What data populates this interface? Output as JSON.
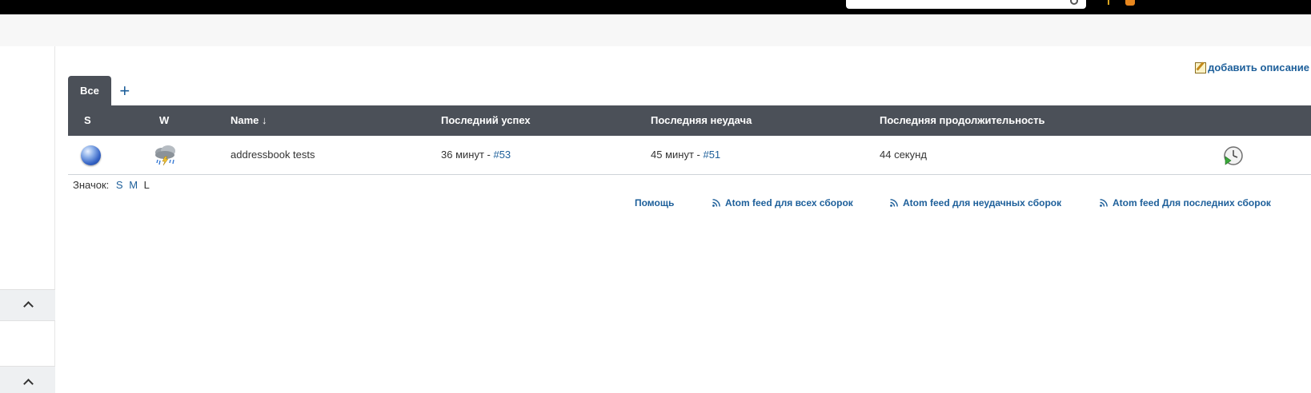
{
  "header": {
    "brand_colors": {
      "topbar": "#000000",
      "accent": "#e8871e"
    }
  },
  "description": {
    "add_label": "добавить описание"
  },
  "tabs": [
    {
      "label": "Все",
      "active": true
    }
  ],
  "tab_add_label": "+",
  "table": {
    "columns": [
      {
        "label": "S"
      },
      {
        "label": "W"
      },
      {
        "label": "Name ↓"
      },
      {
        "label": "Последний успех"
      },
      {
        "label": "Последняя неудача"
      },
      {
        "label": "Последняя продолжительность"
      }
    ],
    "rows": [
      {
        "status_icon": "blue-ball-success-icon",
        "weather_icon": "thunderstorm-weather-icon",
        "name": "addressbook tests",
        "last_success_time": "36 минут",
        "last_success_sep": " - ",
        "last_success_build": "#53",
        "last_failure_time": "45 минут",
        "last_failure_sep": " - ",
        "last_failure_build": "#51",
        "last_duration": "44 секунд",
        "action_icon": "schedule-build-icon"
      }
    ]
  },
  "icon_size": {
    "label": "Значок:",
    "small": "S",
    "medium": "M",
    "large": "L"
  },
  "footer_links": {
    "help": "Помощь",
    "feed_all": "Atom feed для всех сборок",
    "feed_failed": "Atom feed для неудачных сборок",
    "feed_latest": "Atom feed Для последних сборок"
  }
}
